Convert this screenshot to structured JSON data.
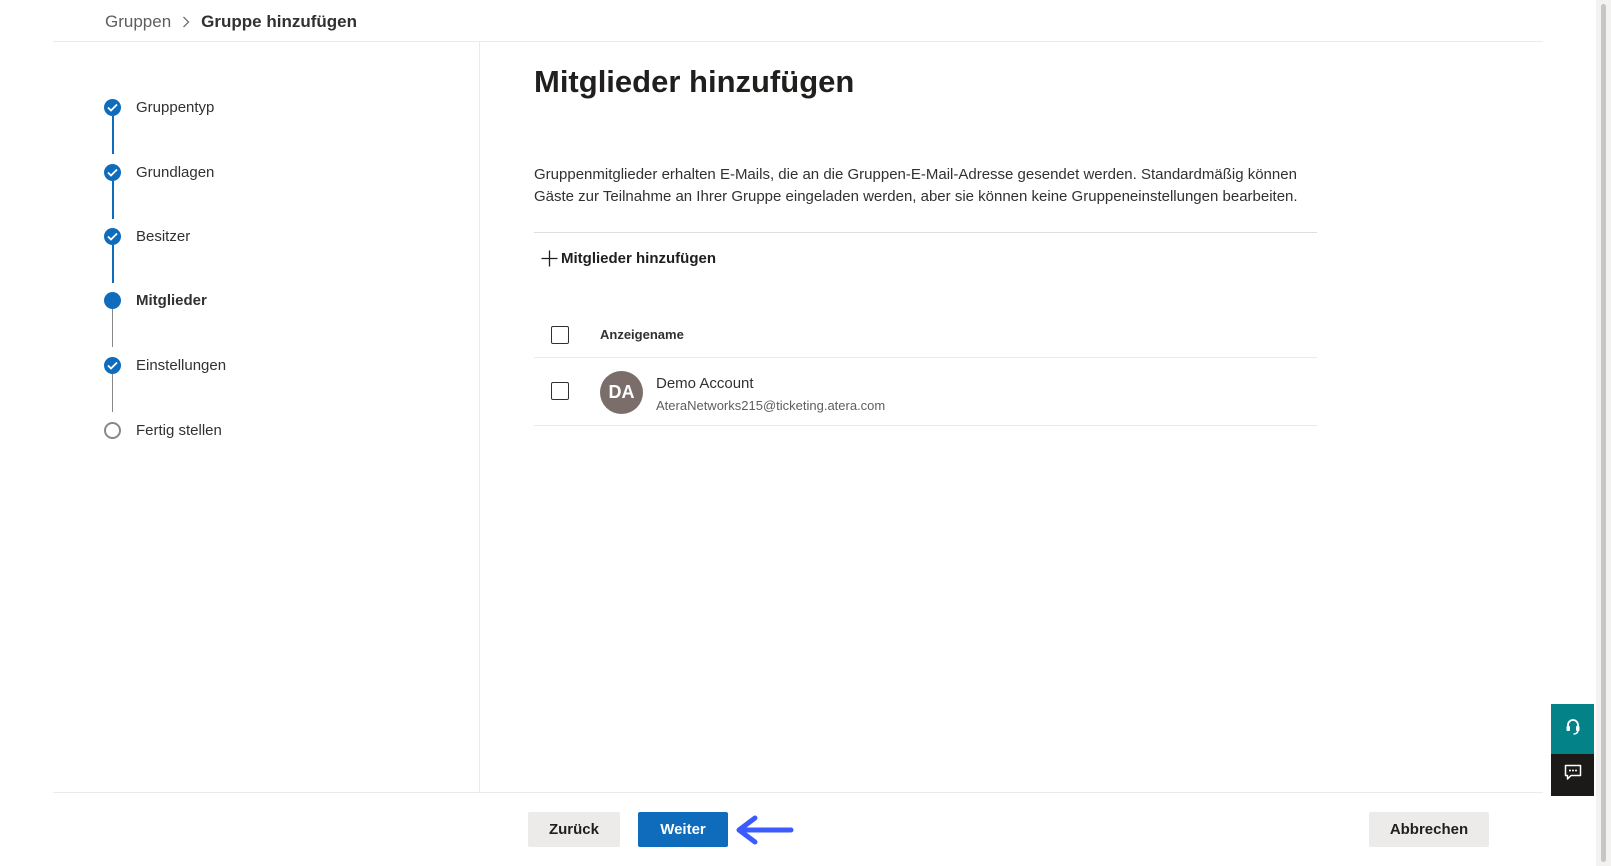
{
  "breadcrumb": {
    "parent": "Gruppen",
    "current": "Gruppe hinzufügen"
  },
  "steps": [
    {
      "label": "Gruppentyp",
      "status": "done"
    },
    {
      "label": "Grundlagen",
      "status": "done"
    },
    {
      "label": "Besitzer",
      "status": "done"
    },
    {
      "label": "Mitglieder",
      "status": "current"
    },
    {
      "label": "Einstellungen",
      "status": "done"
    },
    {
      "label": "Fertig stellen",
      "status": "pending"
    }
  ],
  "main": {
    "title": "Mitglieder hinzufügen",
    "description": "Gruppenmitglieder erhalten E-Mails, die an die Gruppen-E-Mail-Adresse gesendet werden. Standardmäßig können Gäste zur Teilnahme an Ihrer Gruppe eingeladen werden, aber sie können keine Gruppeneinstellungen bearbeiten.",
    "add_members_label": "Mitglieder hinzufügen",
    "table": {
      "column_header": "Anzeigename",
      "rows": [
        {
          "initials": "DA",
          "name": "Demo Account",
          "email": "AteraNetworks215@ticketing.atera.com"
        }
      ]
    }
  },
  "footer": {
    "back_label": "Zurück",
    "next_label": "Weiter",
    "cancel_label": "Abbrechen"
  },
  "colors": {
    "primary": "#0f6cbd",
    "help_tab": "#038387",
    "feedback_tab": "#1b1a19",
    "annotation_arrow": "#3b5bff",
    "avatar": "#7a6d6a"
  },
  "icons": {
    "breadcrumb_separator": "chevron-right-icon",
    "step_done": "checkmark-circle-icon",
    "add": "plus-icon",
    "help": "headset-icon",
    "feedback": "feedback-icon"
  }
}
